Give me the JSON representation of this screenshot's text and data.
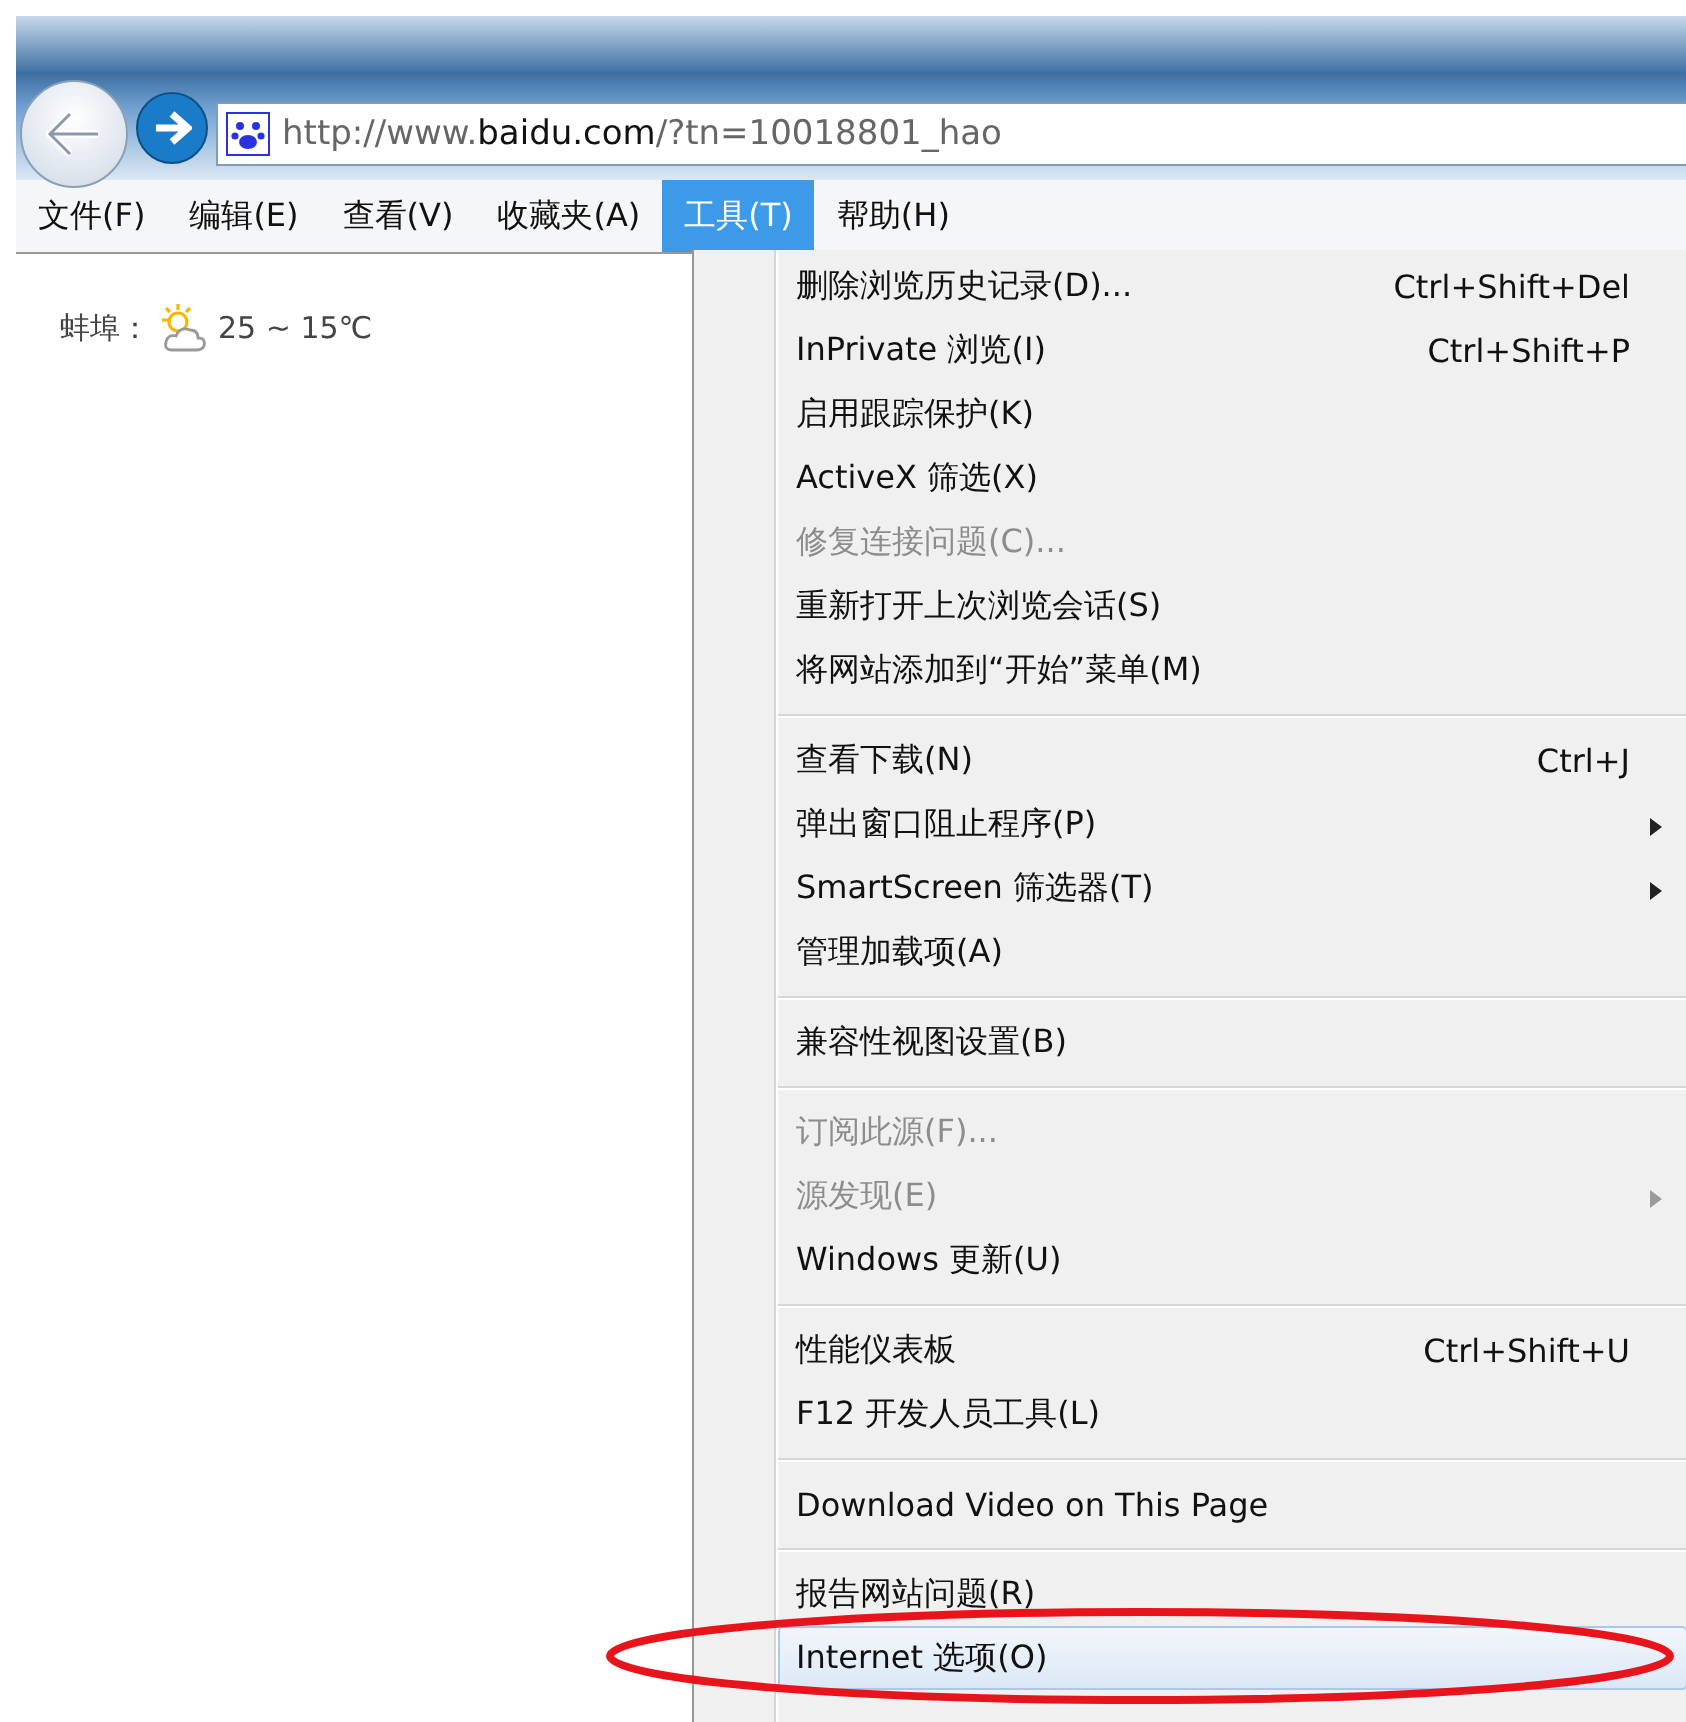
{
  "address_bar": {
    "url_prefix": "http://www.",
    "url_domain": "baidu.com",
    "url_rest": "/?tn=10018801_hao"
  },
  "menu_bar": [
    {
      "label": "文件(F)",
      "selected": false
    },
    {
      "label": "编辑(E)",
      "selected": false
    },
    {
      "label": "查看(V)",
      "selected": false
    },
    {
      "label": "收藏夹(A)",
      "selected": false
    },
    {
      "label": "工具(T)",
      "selected": true
    },
    {
      "label": "帮助(H)",
      "selected": false
    }
  ],
  "weather": {
    "city": "蚌埠：",
    "temperature": "25 ~ 15℃"
  },
  "tools_menu": [
    [
      {
        "label": "删除浏览历史记录(D)...",
        "shortcut": "Ctrl+Shift+Del",
        "disabled": false,
        "submenu": false,
        "selected": false
      },
      {
        "label": "InPrivate 浏览(I)",
        "shortcut": "Ctrl+Shift+P",
        "disabled": false,
        "submenu": false,
        "selected": false
      },
      {
        "label": "启用跟踪保护(K)",
        "disabled": false,
        "submenu": false,
        "selected": false
      },
      {
        "label": "ActiveX 筛选(X)",
        "disabled": false,
        "submenu": false,
        "selected": false
      },
      {
        "label": "修复连接问题(C)...",
        "disabled": true,
        "submenu": false,
        "selected": false
      },
      {
        "label": "重新打开上次浏览会话(S)",
        "disabled": false,
        "submenu": false,
        "selected": false
      },
      {
        "label": "将网站添加到“开始”菜单(M)",
        "disabled": false,
        "submenu": false,
        "selected": false
      }
    ],
    [
      {
        "label": "查看下载(N)",
        "shortcut": "Ctrl+J",
        "disabled": false,
        "submenu": false,
        "selected": false
      },
      {
        "label": "弹出窗口阻止程序(P)",
        "disabled": false,
        "submenu": true,
        "selected": false
      },
      {
        "label": "SmartScreen 筛选器(T)",
        "disabled": false,
        "submenu": true,
        "selected": false
      },
      {
        "label": "管理加载项(A)",
        "disabled": false,
        "submenu": false,
        "selected": false
      }
    ],
    [
      {
        "label": "兼容性视图设置(B)",
        "disabled": false,
        "submenu": false,
        "selected": false
      }
    ],
    [
      {
        "label": "订阅此源(F)...",
        "disabled": true,
        "submenu": false,
        "selected": false
      },
      {
        "label": "源发现(E)",
        "disabled": true,
        "submenu": true,
        "selected": false
      },
      {
        "label": "Windows 更新(U)",
        "disabled": false,
        "submenu": false,
        "selected": false
      }
    ],
    [
      {
        "label": "性能仪表板",
        "shortcut": "Ctrl+Shift+U",
        "disabled": false,
        "submenu": false,
        "selected": false
      },
      {
        "label": "F12 开发人员工具(L)",
        "disabled": false,
        "submenu": false,
        "selected": false
      }
    ],
    [
      {
        "label": "Download Video on This Page",
        "disabled": false,
        "submenu": false,
        "selected": false
      }
    ],
    [
      {
        "label": "报告网站问题(R)",
        "disabled": false,
        "submenu": false,
        "selected": false
      },
      {
        "label": "Internet 选项(O)",
        "disabled": false,
        "submenu": false,
        "selected": true
      }
    ]
  ]
}
